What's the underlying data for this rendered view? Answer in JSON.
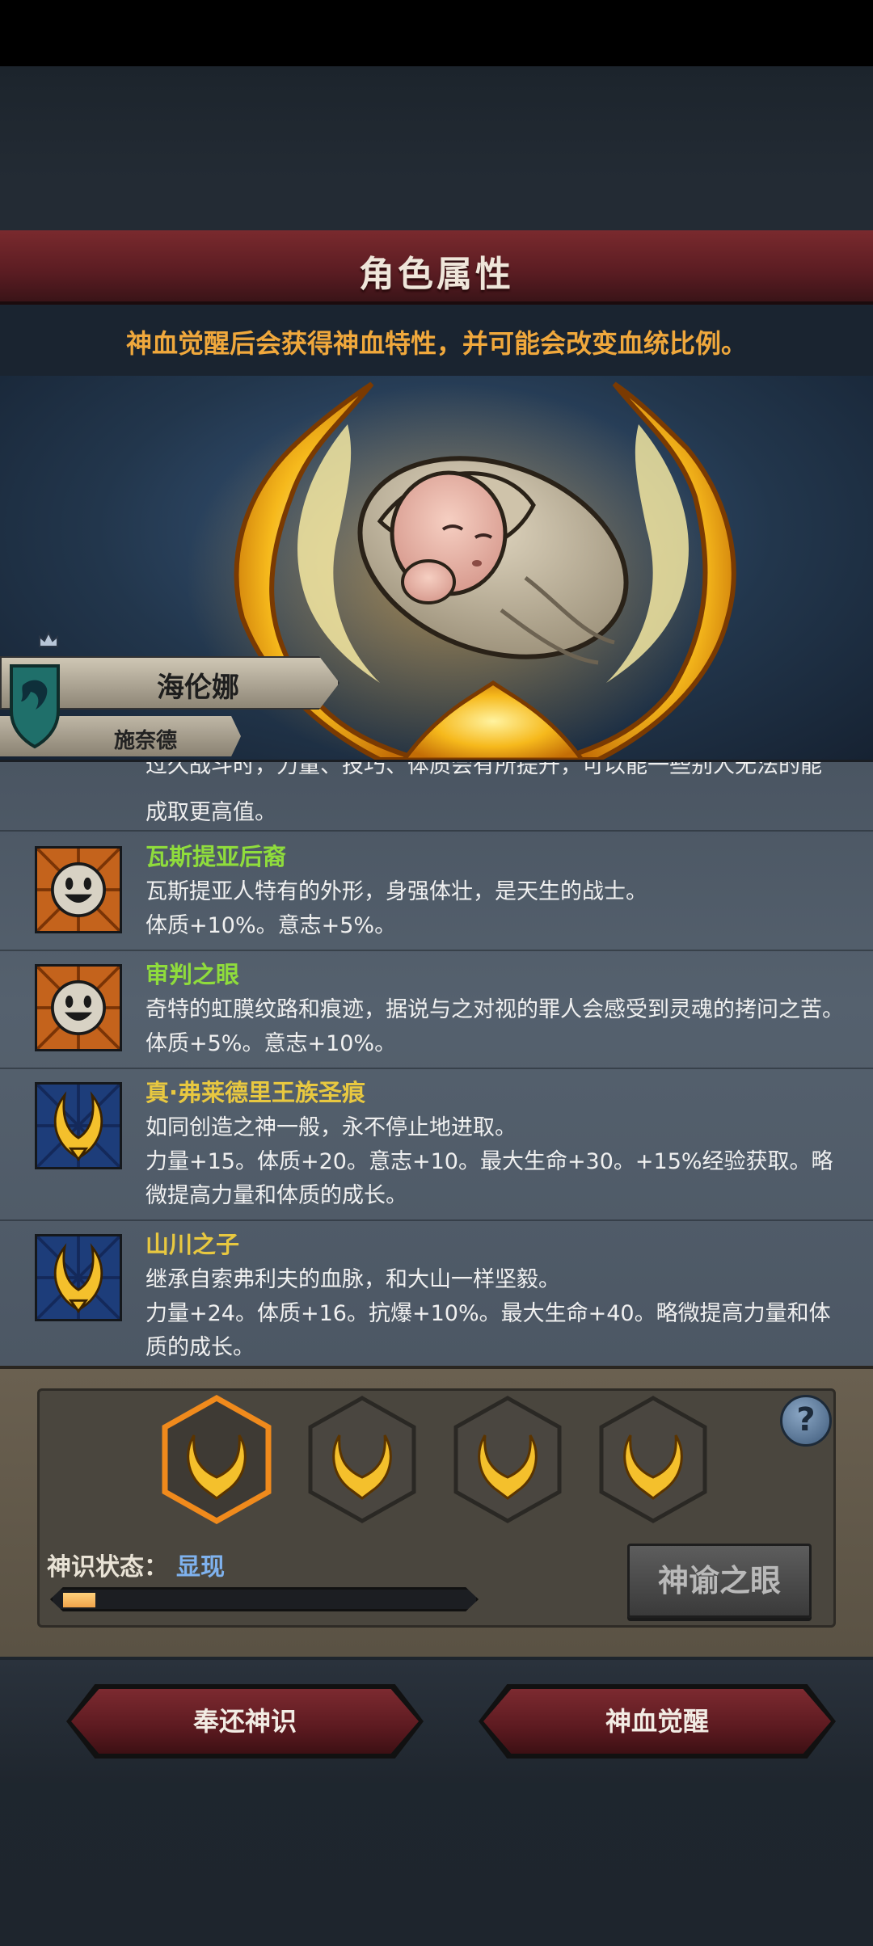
{
  "header": {
    "title": "角色属性",
    "subtitle": "神血觉醒后会获得神血特性，并可能会改变血统比例。"
  },
  "character": {
    "name": "海伦娜",
    "clan": "施奈德"
  },
  "traits": {
    "partial_top_line": "过久战斗时，力量、技巧、体质会有所提升，可以能一些别人无法的能",
    "partial_tail": "成取更高值。",
    "items": [
      {
        "name": "瓦斯提亚后裔",
        "name_color": "#8fdc3c",
        "icon": "smiling-face-icon",
        "lines": [
          "瓦斯提亚人特有的外形，身强体壮，是天生的战士。",
          "体质+10%。意志+5%。"
        ]
      },
      {
        "name": "审判之眼",
        "name_color": "#8fdc3c",
        "icon": "smiling-face-icon",
        "lines": [
          "奇特的虹膜纹路和痕迹，据说与之对视的罪人会感受到灵魂的拷问之苦。",
          "体质+5%。意志+10%。"
        ]
      },
      {
        "name": "真·弗莱德里王族圣痕",
        "name_color": "#e8c840",
        "icon": "golden-flame-crest-icon",
        "lines": [
          "如同创造之神一般，永不停止地进取。",
          "力量+15。体质+20。意志+10。最大生命+30。+15%经验获取。略",
          "微提高力量和体质的成长。"
        ]
      },
      {
        "name": "山川之子",
        "name_color": "#e8c840",
        "icon": "golden-flame-crest-icon",
        "lines": [
          "继承自索弗利夫的血脉，和大山一样坚毅。",
          "力量+24。体质+16。抗爆+10%。最大生命+40。略微提高力量和体",
          "质的成长。"
        ]
      }
    ]
  },
  "slots": {
    "count": 4,
    "selected_index": 0,
    "help_label": "?"
  },
  "divine_state": {
    "label": "神识状态：",
    "value": "显现",
    "progress": 0.08
  },
  "buttons": {
    "oracle": "神谕之眼",
    "return": "奉还神识",
    "awaken": "神血觉醒"
  },
  "colors": {
    "accent_red": "#6a2026",
    "subtitle_orange": "#f0a83c",
    "state_blue": "#7fb2ee"
  }
}
